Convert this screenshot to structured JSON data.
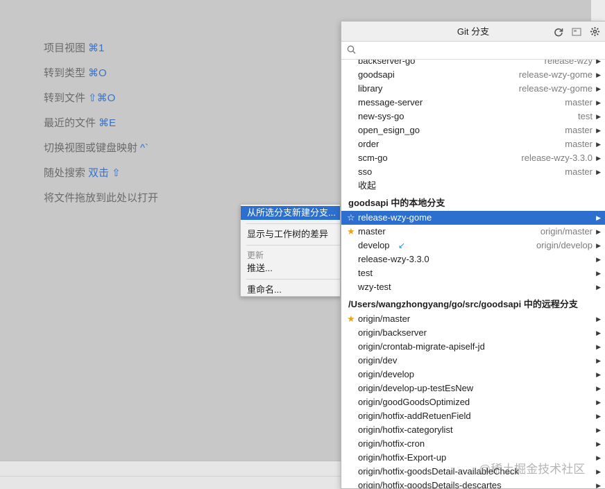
{
  "hints": [
    {
      "text": "项目视图",
      "key": "⌘1"
    },
    {
      "text": "转到类型",
      "key": "⌘O"
    },
    {
      "text": "转到文件",
      "key": "⇧⌘O"
    },
    {
      "text": "最近的文件",
      "key": "⌘E"
    },
    {
      "text": "切换视图或键盘映射",
      "key": "^`"
    },
    {
      "text": "随处搜索",
      "key": "双击 ⇧"
    },
    {
      "text": "将文件拖放到此处以打开",
      "key": ""
    }
  ],
  "context_menu": {
    "new_branch": "从所选分支新建分支...",
    "show_diff": "显示与工作树的差异",
    "update_header": "更新",
    "push": "推送...",
    "rename": "重命名..."
  },
  "popup": {
    "title": "Git 分支",
    "search_placeholder": "",
    "partial_top": {
      "name": "backserver-go",
      "track": "release-wzy"
    },
    "repos": [
      {
        "name": "goodsapi",
        "track": "release-wzy-gome"
      },
      {
        "name": "library",
        "track": "release-wzy-gome"
      },
      {
        "name": "message-server",
        "track": "master"
      },
      {
        "name": "new-sys-go",
        "track": "test"
      },
      {
        "name": "open_esign_go",
        "track": "master"
      },
      {
        "name": "order",
        "track": "master"
      },
      {
        "name": "scm-go",
        "track": "release-wzy-3.3.0"
      },
      {
        "name": "sso",
        "track": "master"
      }
    ],
    "collapse_label": "收起",
    "local_header": "goodsapi 中的本地分支",
    "local_branches": [
      {
        "name": "release-wzy-gome",
        "track": "",
        "star": "outline",
        "selected": true
      },
      {
        "name": "master",
        "track": "origin/master",
        "star": "filled"
      },
      {
        "name": "develop",
        "track": "origin/develop",
        "star": "",
        "incoming": "↙"
      },
      {
        "name": "release-wzy-3.3.0",
        "track": "",
        "star": ""
      },
      {
        "name": "test",
        "track": "",
        "star": ""
      },
      {
        "name": "wzy-test",
        "track": "",
        "star": ""
      }
    ],
    "remote_header": "/Users/wangzhongyang/go/src/goodsapi 中的远程分支",
    "remote_branches": [
      {
        "name": "origin/master",
        "star": "filled"
      },
      {
        "name": "origin/backserver"
      },
      {
        "name": "origin/crontab-migrate-apiself-jd"
      },
      {
        "name": "origin/dev"
      },
      {
        "name": "origin/develop"
      },
      {
        "name": "origin/develop-up-testEsNew"
      },
      {
        "name": "origin/goodGoodsOptimized"
      },
      {
        "name": "origin/hotfix-addRetuenField"
      },
      {
        "name": "origin/hotfix-categorylist"
      },
      {
        "name": "origin/hotfix-cron"
      },
      {
        "name": "origin/hotfix-Export-up"
      },
      {
        "name": "origin/hotfix-goodsDetail-availableCheck"
      },
      {
        "name": "origin/hotfix-goodsDetails-descartes"
      }
    ],
    "icons": [
      "refresh-icon",
      "panel-icon",
      "gear-icon"
    ]
  },
  "watermark": "@稀土掘金技术社区",
  "colors": {
    "accent": "#2d6fcf",
    "star": "#f0a30a",
    "hint_key": "#3b73c4"
  }
}
